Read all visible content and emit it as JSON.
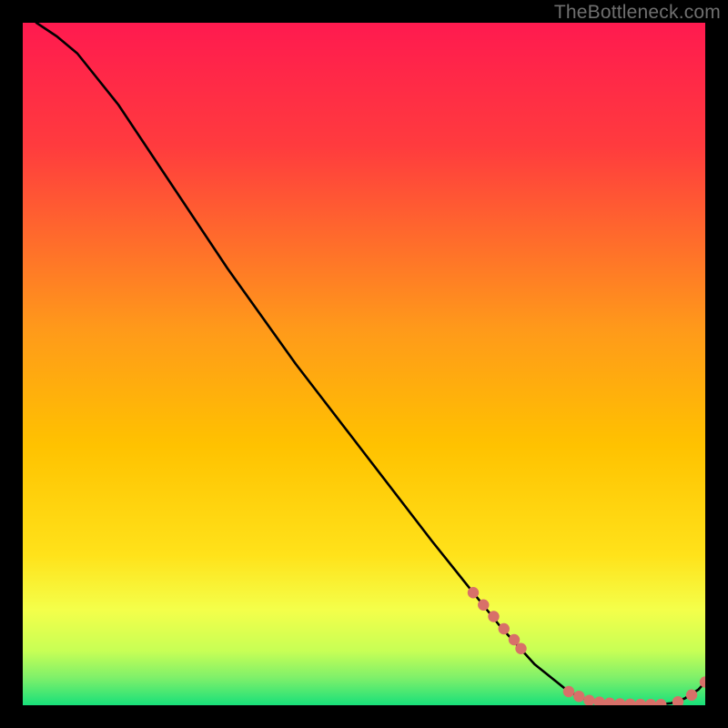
{
  "watermark": "TheBottleneck.com",
  "colors": {
    "bg": "#000000",
    "grad_top": "#ff1a4f",
    "grad_mid": "#ffc200",
    "grad_low": "#f4ff4a",
    "grad_bottom": "#18e07a",
    "curve": "#000000",
    "marker": "#d87069"
  },
  "chart_data": {
    "type": "line",
    "title": "",
    "xlabel": "",
    "ylabel": "",
    "xlim": [
      0,
      100
    ],
    "ylim": [
      0,
      100
    ],
    "description": "Bottleneck/mismatch curve: value descends from ~100 at x≈2 to ~0 near x≈83, stays near 0 until x≈96, then rises slightly by x=100. Salmon dot markers cluster along the line at x≈66–73 (on the descending slope) and x≈80–99 (along the floor and slight uptick).",
    "series": [
      {
        "name": "curve",
        "x": [
          2,
          5,
          8,
          10,
          14,
          20,
          30,
          40,
          50,
          60,
          66,
          70,
          75,
          80,
          83,
          86,
          90,
          93,
          95,
          97,
          99,
          100
        ],
        "y": [
          100,
          98,
          95.5,
          93,
          88,
          79,
          64,
          50,
          37,
          24,
          16.5,
          11.5,
          6,
          2,
          0.6,
          0.2,
          0.1,
          0.1,
          0.3,
          1.0,
          2.3,
          3.4
        ]
      }
    ],
    "markers": {
      "name": "highlighted-points",
      "x": [
        66,
        67.5,
        69,
        70.5,
        72,
        73,
        80,
        81.5,
        83,
        84.5,
        86,
        87.5,
        89,
        90.5,
        92,
        93.5,
        96,
        98,
        100
      ],
      "y": [
        16.5,
        14.7,
        13,
        11.2,
        9.6,
        8.3,
        2.0,
        1.3,
        0.7,
        0.45,
        0.3,
        0.2,
        0.15,
        0.12,
        0.1,
        0.1,
        0.5,
        1.5,
        3.4
      ]
    }
  }
}
